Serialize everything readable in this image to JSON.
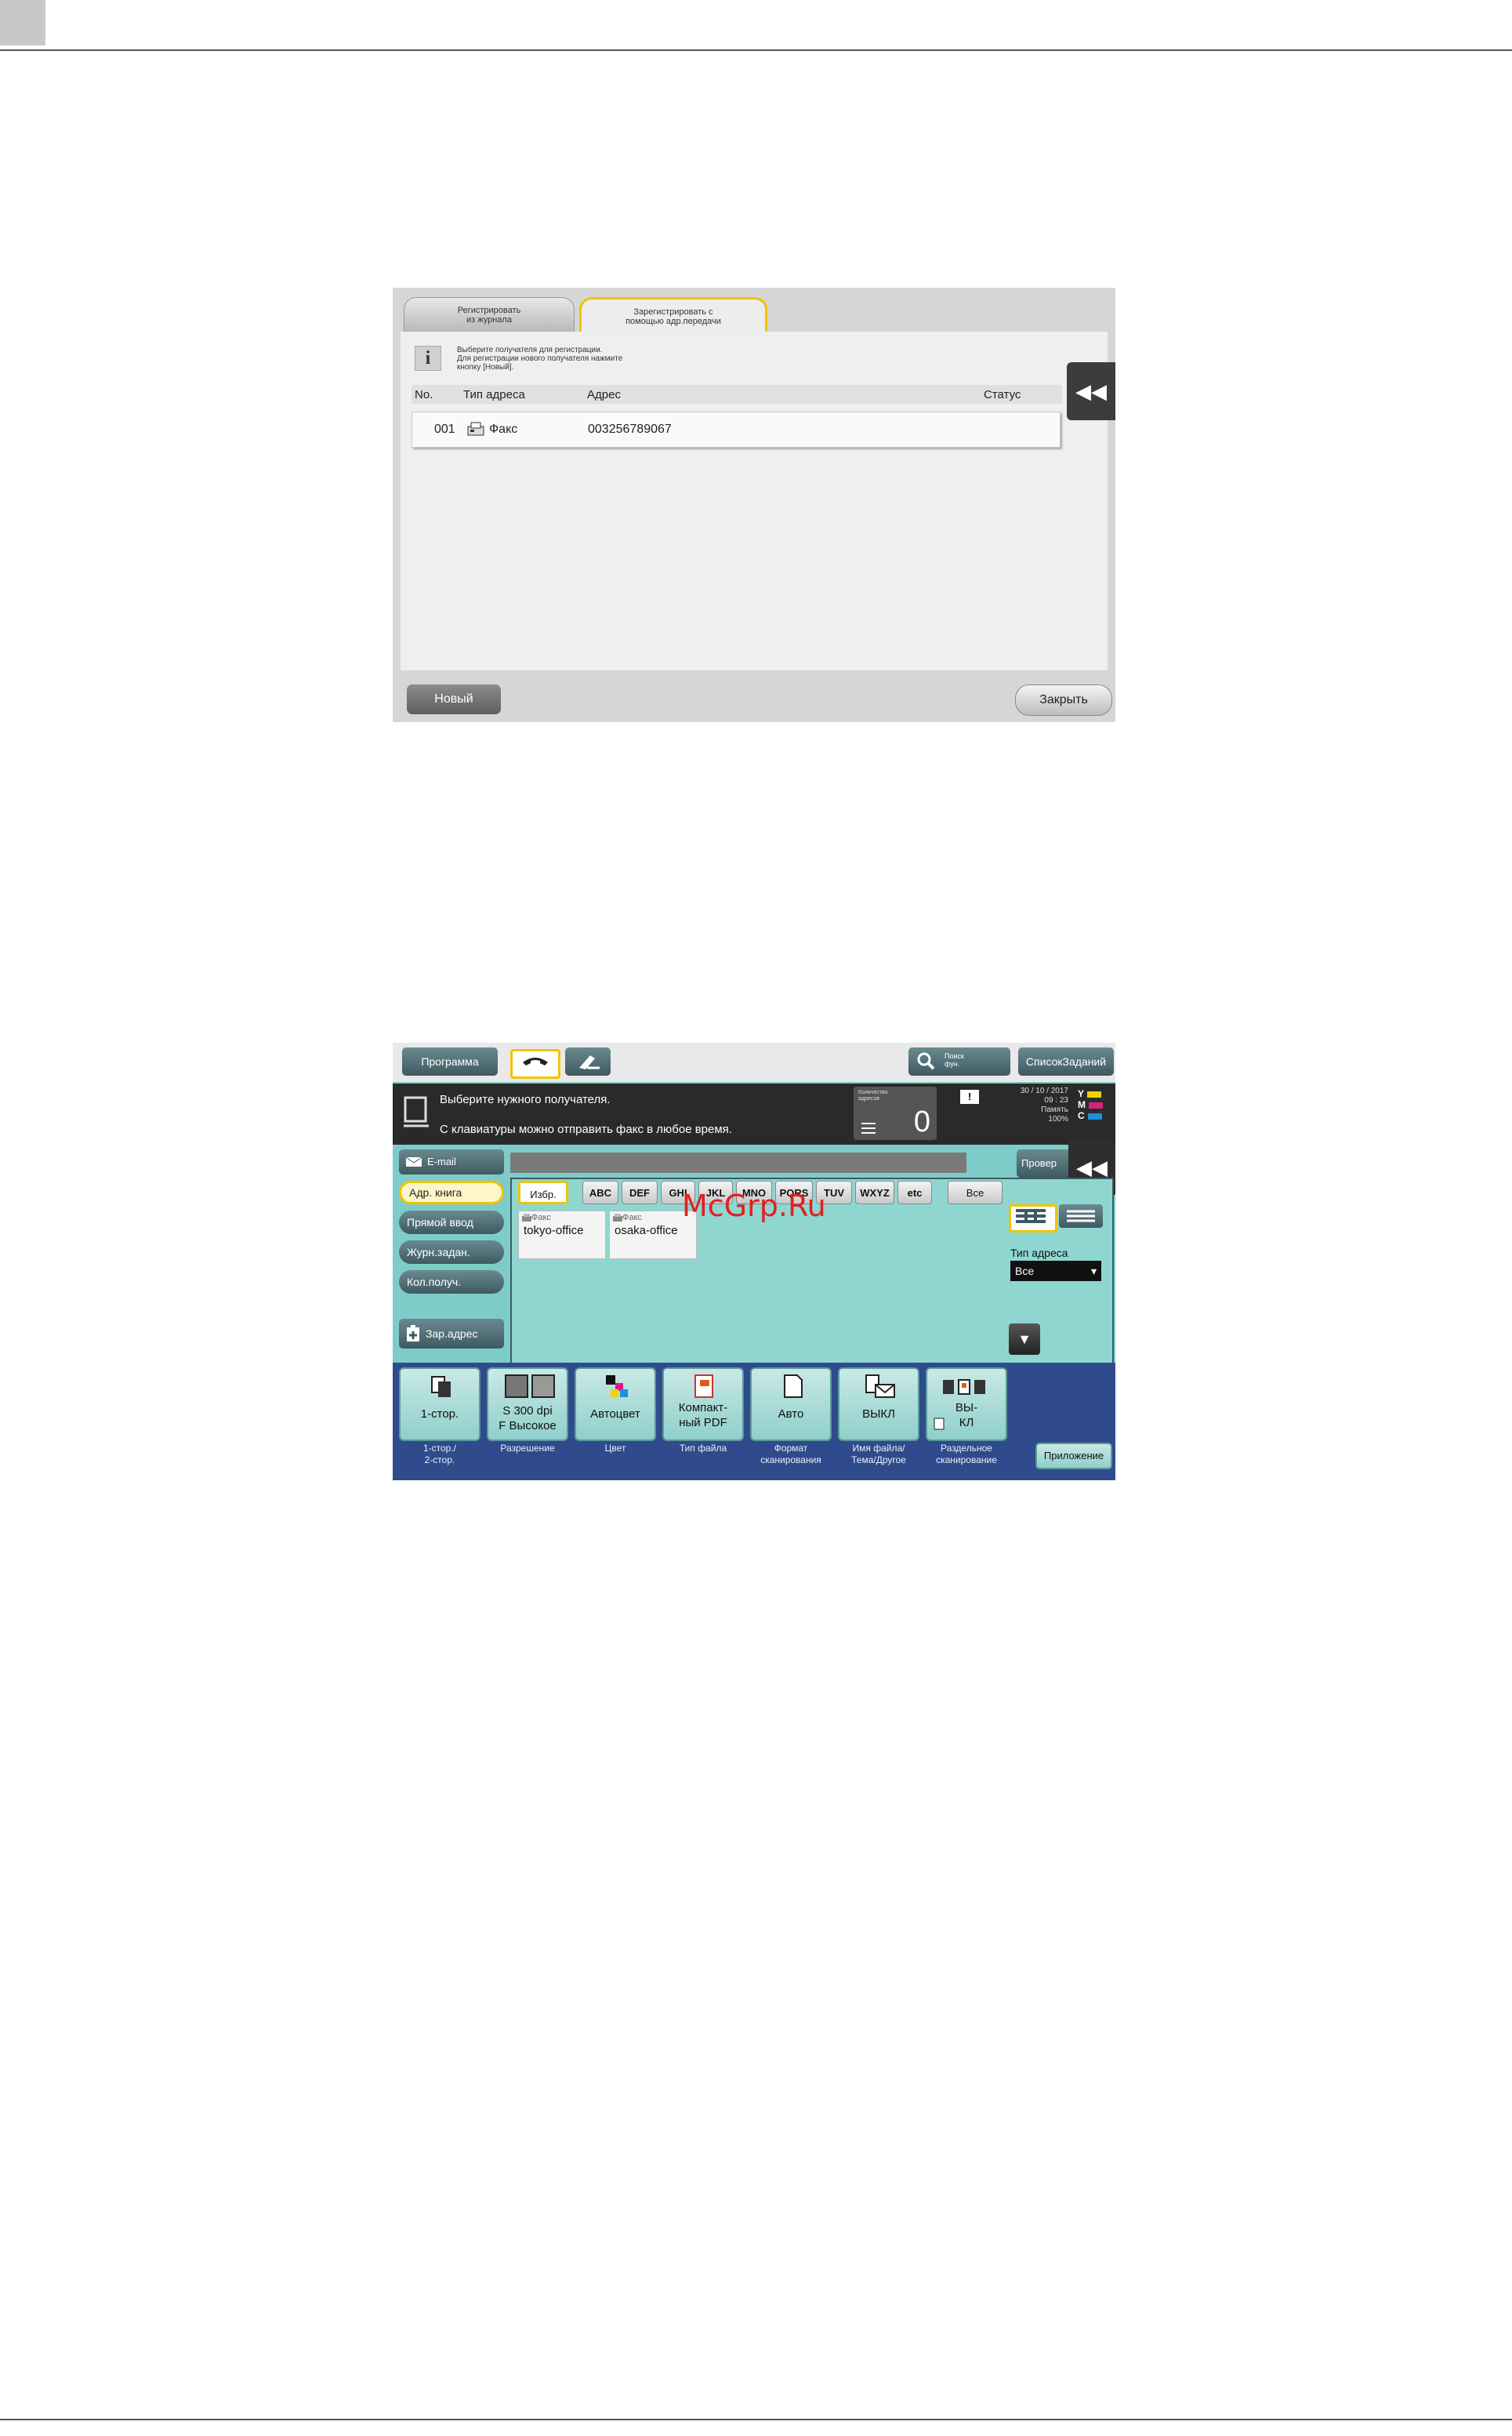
{
  "screen1": {
    "tabs": [
      {
        "label": "Регистрировать\nиз журнала"
      },
      {
        "label": "Зарегистрировать с\nпомощью адр.передачи"
      }
    ],
    "info_text": "Выберите получателя для регистрации.\nДля регистрации нового получателя нажмите\nкнопку [Новый].",
    "columns": {
      "no": "No.",
      "type": "Тип адреса",
      "address": "Адрес",
      "status": "Статус"
    },
    "row": {
      "no": "001",
      "type": "Факс",
      "address": "003256789067",
      "status": ""
    },
    "collapse_icon": "double-chevron-left-icon",
    "buttons": {
      "new": "Новый",
      "close": "Закрыть"
    }
  },
  "screen2": {
    "program": "Программа",
    "search_label": "Поиск\nфун.",
    "joblist": "СписокЗаданий",
    "message_line1": "Выберите нужного получателя.",
    "message_line2": "С клавиатуры можно отправить факс в любое время.",
    "counter_label": "Количество\nадресов",
    "counter_value": "0",
    "datetime": "30 / 10 / 2017\n09 : 23\nПамять\n100%",
    "toner": [
      {
        "letter": "Y",
        "color": "#f2d200"
      },
      {
        "letter": "M",
        "color": "#d6247a"
      },
      {
        "letter": "C",
        "color": "#1e8fd8"
      }
    ],
    "email_tab": "E-mail",
    "check_button": "Провер",
    "side": [
      "Адр. книга",
      "Прямой ввод",
      "Журн.задан.",
      "Кол.получ."
    ],
    "register_addr": "Зар.адрес",
    "index": [
      "Избр.",
      "ABC",
      "DEF",
      "GHI",
      "JKL",
      "MNO",
      "PQRS",
      "TUV",
      "WXYZ",
      "etc",
      "Все"
    ],
    "cards": [
      {
        "type": "Факс",
        "name": "tokyo-office"
      },
      {
        "type": "Факс",
        "name": "osaka-office"
      }
    ],
    "address_type_label": "Тип адреса",
    "address_type_value": "Все",
    "functions": [
      {
        "value": "1-стор.",
        "caption": "1-стор./\n2-стор."
      },
      {
        "value": "S 300 dpi\nF Высокое",
        "caption": "Разрешение"
      },
      {
        "value": "Автоцвет",
        "caption": "Цвет"
      },
      {
        "value": "Компакт-\nный PDF",
        "caption": "Тип файла"
      },
      {
        "value": "Авто",
        "caption": "Формат\nсканирования"
      },
      {
        "value": "ВЫКЛ",
        "caption": "Имя файла/\nТема/Другое"
      },
      {
        "value": "ВЫ-\nКЛ",
        "caption": "Раздельное\nсканирование"
      }
    ],
    "app_button": "Приложение"
  },
  "watermark": "McGrp.Ru"
}
